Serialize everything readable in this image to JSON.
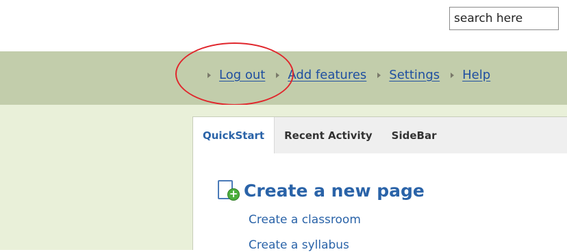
{
  "search": {
    "placeholder": "search here"
  },
  "nav": {
    "items": [
      {
        "label": "Log out"
      },
      {
        "label": "Add features"
      },
      {
        "label": "Settings"
      },
      {
        "label": "Help"
      }
    ]
  },
  "tabs": [
    {
      "label": "QuickStart",
      "active": true
    },
    {
      "label": "Recent Activity",
      "active": false
    },
    {
      "label": "SideBar",
      "active": false
    }
  ],
  "quickstart": {
    "create_title": "Create a new page",
    "links": [
      "Create a classroom",
      "Create a syllabus"
    ]
  },
  "colors": {
    "nav_bg": "#c2cdab",
    "link": "#1f4fa0",
    "accent_blue": "#2a63a8",
    "content_bg": "#e9f0d9",
    "highlight_circle": "#e0262c"
  }
}
